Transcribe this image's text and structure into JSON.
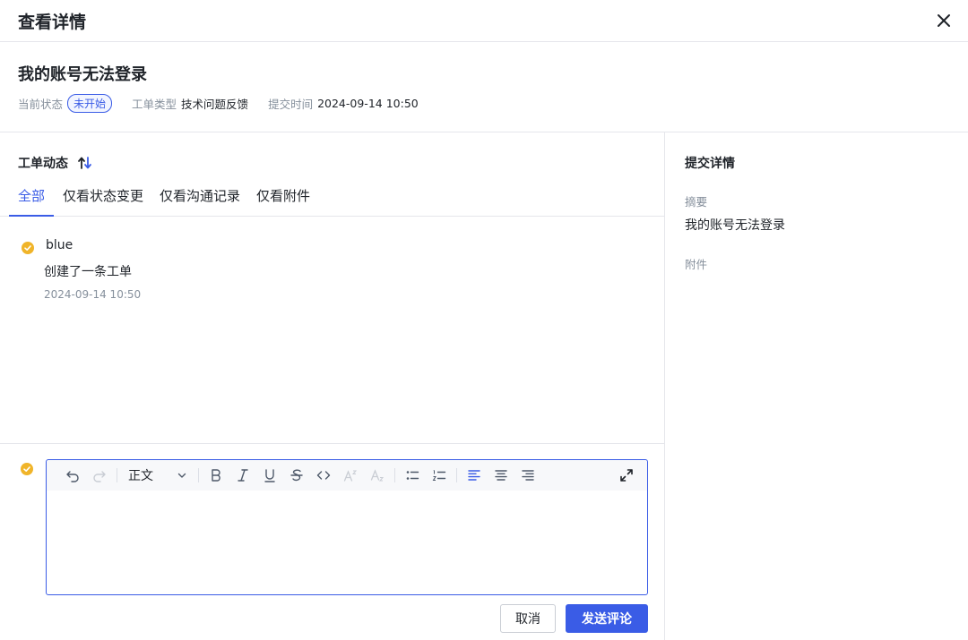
{
  "header": {
    "title": "查看详情"
  },
  "ticket": {
    "title": "我的账号无法登录",
    "status_label": "当前状态",
    "status_value": "未开始",
    "type_label": "工单类型",
    "type_value": "技术问题反馈",
    "time_label": "提交时间",
    "time_value": "2024-09-14 10:50"
  },
  "activity_section": {
    "title": "工单动态",
    "tabs": [
      {
        "label": "全部",
        "active": true
      },
      {
        "label": "仅看状态变更",
        "active": false
      },
      {
        "label": "仅看沟通记录",
        "active": false
      },
      {
        "label": "仅看附件",
        "active": false
      }
    ],
    "items": [
      {
        "user": "blue",
        "text": "创建了一条工单",
        "time": "2024-09-14 10:50"
      }
    ]
  },
  "editor": {
    "paragraph_select": "正文",
    "cancel_label": "取消",
    "send_label": "发送评论"
  },
  "details": {
    "title": "提交详情",
    "summary_label": "摘要",
    "summary_value": "我的账号无法登录",
    "attachment_label": "附件"
  },
  "colors": {
    "accent": "#3a5ce6",
    "check": "#f0b429",
    "muted": "#86909c",
    "border": "#e5e6eb"
  }
}
